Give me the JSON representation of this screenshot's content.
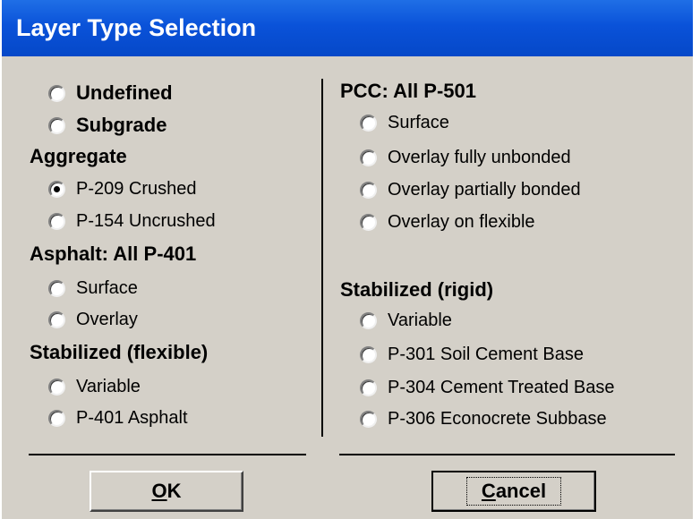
{
  "window": {
    "title": "Layer Type Selection"
  },
  "left": {
    "top_options": [
      {
        "label": "Undefined",
        "selected": false
      },
      {
        "label": "Subgrade",
        "selected": false
      }
    ],
    "groups": [
      {
        "heading": "Aggregate",
        "options": [
          {
            "label": "P-209 Crushed",
            "selected": true
          },
          {
            "label": "P-154 Uncrushed",
            "selected": false
          }
        ]
      },
      {
        "heading": "Asphalt: All P-401",
        "options": [
          {
            "label": "Surface",
            "selected": false
          },
          {
            "label": "Overlay",
            "selected": false
          }
        ]
      },
      {
        "heading": "Stabilized (flexible)",
        "options": [
          {
            "label": "Variable",
            "selected": false
          },
          {
            "label": "P-401 Asphalt",
            "selected": false
          }
        ]
      }
    ]
  },
  "right": {
    "groups": [
      {
        "heading": "PCC: All P-501",
        "options": [
          {
            "label": "Surface",
            "selected": false
          },
          {
            "label": "Overlay fully unbonded",
            "selected": false
          },
          {
            "label": "Overlay partially bonded",
            "selected": false
          },
          {
            "label": "Overlay on flexible",
            "selected": false
          }
        ]
      },
      {
        "heading": "Stabilized (rigid)",
        "options": [
          {
            "label": "Variable",
            "selected": false
          },
          {
            "label": "P-301 Soil Cement Base",
            "selected": false
          },
          {
            "label": "P-304 Cement Treated Base",
            "selected": false
          },
          {
            "label": "P-306 Econocrete Subbase",
            "selected": false
          }
        ]
      }
    ]
  },
  "buttons": {
    "ok_mnemonic": "O",
    "ok_rest": "K",
    "cancel_mnemonic": "C",
    "cancel_rest": "ancel"
  },
  "colors": {
    "titlebar": "#0a52d9",
    "dialog_bg": "#d4d0c8"
  }
}
